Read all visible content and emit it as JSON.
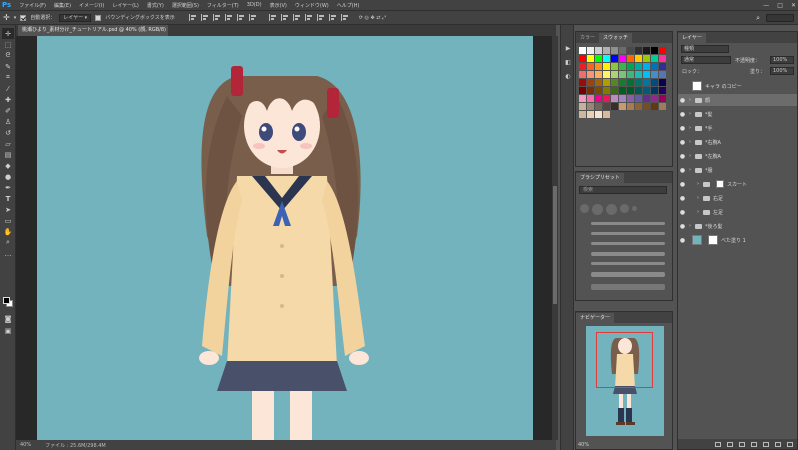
{
  "app": {
    "logo": "Ps"
  },
  "menu": [
    "ファイル(F)",
    "編集(E)",
    "イメージ(I)",
    "レイヤー(L)",
    "書式(Y)",
    "選択範囲(S)",
    "フィルター(T)",
    "3D(D)",
    "表示(V)",
    "ウィンドウ(W)",
    "ヘルプ(H)"
  ],
  "window_controls": [
    "—",
    "□",
    "✕"
  ],
  "options": {
    "auto_select_label": "自動選択：",
    "auto_select_value": "レイヤー",
    "bounding_box_label": "バウンディングボックスを表示"
  },
  "document": {
    "tab_title": "桃瀬ひより_素材分け_チュートリアル.psd @ 40% (顔, RGB/8) *"
  },
  "status": {
    "zoom": "40%",
    "file_info": "ファイル : 25.6M/298.4M"
  },
  "swatches_panel": {
    "tabs": [
      "カラー",
      "スウォッチ"
    ],
    "active_tab": "スウォッチ",
    "colors": [
      "#ffffff",
      "#eeeeee",
      "#d0d0d0",
      "#b2b2b2",
      "#8f8f8f",
      "#6b6b6b",
      "#4a4a4a",
      "#303030",
      "#1a1a1a",
      "#000000",
      "#ff0000",
      "#ff0000",
      "#ffff00",
      "#00ff00",
      "#00ffff",
      "#0000ff",
      "#ff00ff",
      "#ff6600",
      "#ffcc00",
      "#99cc00",
      "#00cc99",
      "#ff3399",
      "#ee1c25",
      "#f26522",
      "#f7941d",
      "#fff200",
      "#8dc63f",
      "#39b54a",
      "#00a651",
      "#00a99d",
      "#00aeef",
      "#0072bc",
      "#2e3192",
      "#ef6e6b",
      "#f69679",
      "#fbaf5d",
      "#fff568",
      "#acd372",
      "#7cc576",
      "#3cb878",
      "#1cbbb4",
      "#00bff3",
      "#448ccb",
      "#5674b9",
      "#9e0b0f",
      "#a0410d",
      "#a36209",
      "#aba000",
      "#598527",
      "#197b30",
      "#007236",
      "#00746b",
      "#0076a3",
      "#004b80",
      "#0d004c",
      "#790000",
      "#7b2e00",
      "#7d4900",
      "#827b00",
      "#406618",
      "#005e20",
      "#005826",
      "#005952",
      "#005b7f",
      "#003663",
      "#21005a",
      "#f49ac1",
      "#f06eaa",
      "#ec008c",
      "#ed145b",
      "#bd8cbf",
      "#a186be",
      "#8560a8",
      "#605ca8",
      "#662d91",
      "#92278f",
      "#9e005d",
      "#c7b299",
      "#998675",
      "#736357",
      "#534741",
      "#37302a",
      "#c69c6d",
      "#a67c52",
      "#8c6239",
      "#754c24",
      "#603913",
      "#9e7b5d",
      "#cbb7a2",
      "#e8d0b8",
      "#f5e3cf",
      "#d9b99b"
    ]
  },
  "brushes_panel": {
    "title": "ブラシプリセット",
    "search_placeholder": "検索"
  },
  "navigator_panel": {
    "title": "ナビゲーター",
    "zoom": "40%"
  },
  "layers_panel": {
    "title": "レイヤー",
    "filter_label": "種類",
    "blend_mode": "通常",
    "opacity_label": "不透明度：",
    "opacity_value": "100%",
    "lock_label": "ロック：",
    "fill_label": "塗り：",
    "fill_value": "100%",
    "layers": [
      {
        "name": "キャラ のコピー",
        "kind": "thumb",
        "visible": false,
        "indent": 0
      },
      {
        "name": "顔",
        "kind": "folder",
        "visible": true,
        "indent": 0,
        "selected": true
      },
      {
        "name": "*髪",
        "kind": "folder",
        "visible": true,
        "indent": 0
      },
      {
        "name": "*手",
        "kind": "folder",
        "visible": true,
        "indent": 0
      },
      {
        "name": "*右腕A",
        "kind": "folder",
        "visible": true,
        "indent": 0
      },
      {
        "name": "*左腕A",
        "kind": "folder",
        "visible": true,
        "indent": 0
      },
      {
        "name": "*服",
        "kind": "folder",
        "visible": true,
        "indent": 0
      },
      {
        "name": "スカート",
        "kind": "folder-mask",
        "visible": true,
        "indent": 1
      },
      {
        "name": "右足",
        "kind": "folder",
        "visible": true,
        "indent": 1
      },
      {
        "name": "左足",
        "kind": "folder",
        "visible": true,
        "indent": 1
      },
      {
        "name": "*後ろ髪",
        "kind": "folder",
        "visible": true,
        "indent": 0
      },
      {
        "name": "べた塗り 1",
        "kind": "fill",
        "visible": true,
        "indent": 0
      }
    ]
  }
}
